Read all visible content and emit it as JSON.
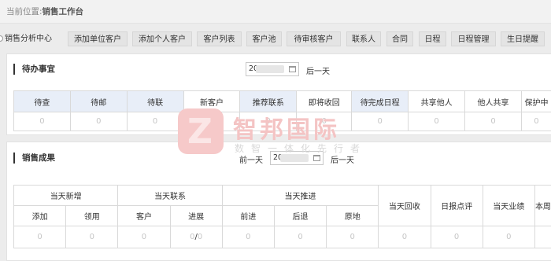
{
  "breadcrumb": {
    "prefix": "当前位置:",
    "current": "销售工作台"
  },
  "tabs": [
    "销售分析中心",
    "添加单位客户",
    "添加个人客户",
    "客户列表",
    "客户池",
    "待审核客户",
    "联系人",
    "合同",
    "日程",
    "日程管理",
    "生日提醒"
  ],
  "todo": {
    "title": "待办事宜",
    "date_value": "20",
    "next_label": "后一天",
    "headers": [
      "待查",
      "待邮",
      "待联",
      "新客户",
      "推荐联系",
      "即将收回",
      "待完成日程",
      "共享他人",
      "他人共享",
      "保护中"
    ],
    "values": [
      "0",
      "0",
      "0",
      "0",
      "0",
      "0",
      "0",
      "0",
      "0",
      "0"
    ]
  },
  "results": {
    "title": "销售成果",
    "prev_label": "前一天",
    "date_value": "20",
    "next_label": "后一天",
    "groups": [
      "当天新增",
      "当天联系",
      "当天推进"
    ],
    "sub_headers": [
      "添加",
      "领用",
      "客户",
      "进展",
      "前进",
      "后退",
      "原地"
    ],
    "single_headers": [
      "当天回收",
      "日报点评",
      "当天业绩",
      "本周"
    ],
    "values": [
      "0",
      "0",
      "0",
      "0",
      "0",
      "0",
      "0",
      "0",
      "0",
      "0",
      "0"
    ],
    "progress_sep": "/"
  },
  "watermark": {
    "big": "智邦国际",
    "small": "数智一体化先行者"
  }
}
